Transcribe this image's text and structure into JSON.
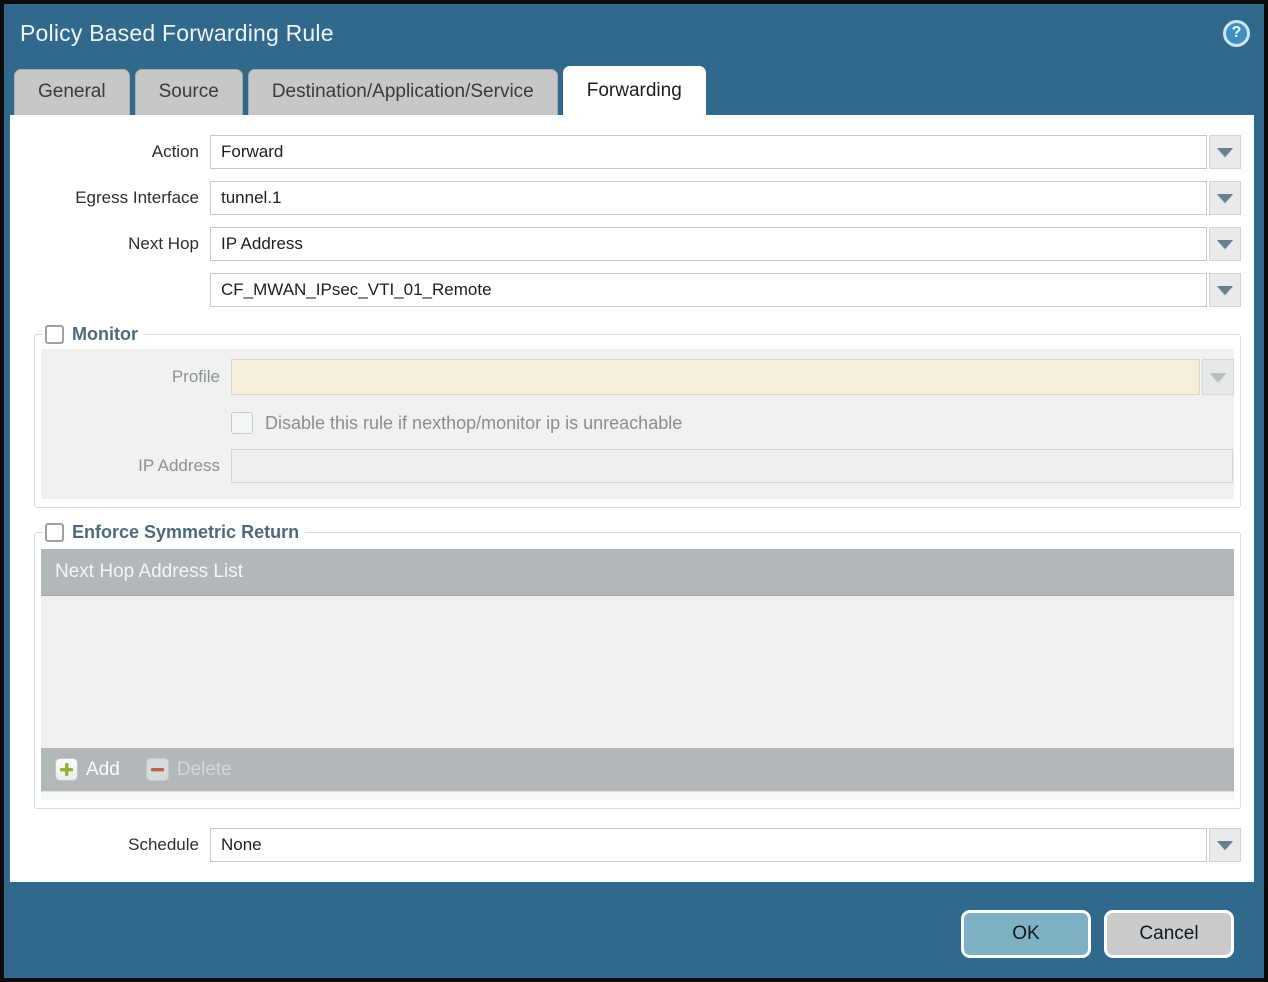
{
  "dialog": {
    "title": "Policy Based Forwarding Rule",
    "help_icon_glyph": "?"
  },
  "tabs": [
    {
      "label": "General",
      "active": false
    },
    {
      "label": "Source",
      "active": false
    },
    {
      "label": "Destination/Application/Service",
      "active": false
    },
    {
      "label": "Forwarding",
      "active": true
    }
  ],
  "form": {
    "action": {
      "label": "Action",
      "value": "Forward"
    },
    "egress_interface": {
      "label": "Egress Interface",
      "value": "tunnel.1"
    },
    "next_hop": {
      "label": "Next Hop",
      "value": "IP Address"
    },
    "next_hop_address": {
      "label": "",
      "value": "CF_MWAN_IPsec_VTI_01_Remote"
    },
    "schedule": {
      "label": "Schedule",
      "value": "None"
    }
  },
  "monitor": {
    "legend": "Monitor",
    "checked": false,
    "profile": {
      "label": "Profile",
      "value": ""
    },
    "disable_rule": {
      "label": "Disable this rule if nexthop/monitor ip is unreachable",
      "checked": false
    },
    "ip_address": {
      "label": "IP Address",
      "value": ""
    }
  },
  "enforce_symmetric_return": {
    "legend": "Enforce Symmetric Return",
    "checked": false,
    "table": {
      "header": "Next Hop Address List",
      "rows": []
    },
    "add_label": "Add",
    "delete_label": "Delete"
  },
  "footer": {
    "ok_label": "OK",
    "cancel_label": "Cancel"
  },
  "colors": {
    "dialog_background": "#31698c",
    "active_tab_background": "#ffffff",
    "inactive_tab_background": "#c6c7c8",
    "legend_text": "#4e6a7a",
    "disabled_field_cream": "#f4eedb",
    "table_bar_gray": "#b2b7ba",
    "ok_button": "#7fb0c3",
    "cancel_button": "#c9cbcd",
    "add_icon_green": "#94ad3e",
    "delete_icon_red": "#b2654e"
  }
}
